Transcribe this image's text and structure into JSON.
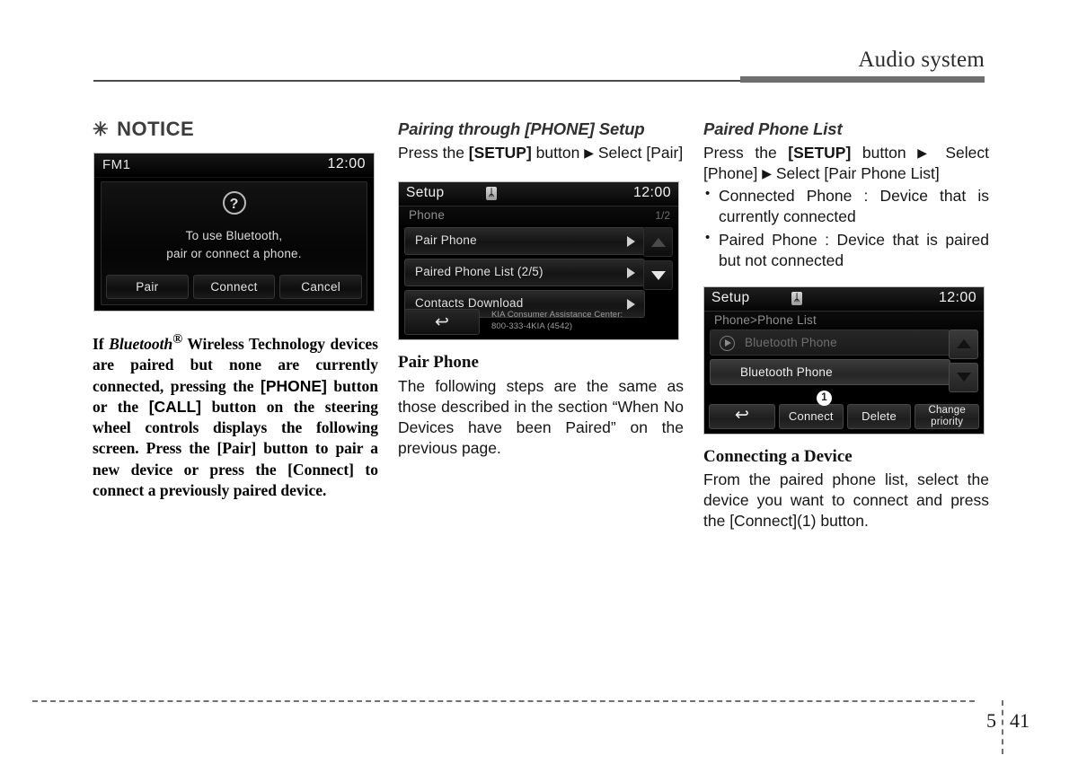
{
  "header": {
    "title": "Audio system"
  },
  "footer": {
    "chapter": "5",
    "page": "41"
  },
  "left_column": {
    "notice_asterisk": "✳",
    "notice_heading": "NOTICE",
    "screen": {
      "source_label": "FM1",
      "clock": "12:00",
      "icon_question": "?",
      "message_line1": "To use Bluetooth,",
      "message_line2": "pair or connect a phone.",
      "buttons": [
        "Pair",
        "Connect",
        "Cancel"
      ]
    },
    "body_html": "If <em>Bluetooth</em><sup>®</sup> Wireless Technology devices are paired but none are currently connected, pressing the <span class=\"bracket-sans\">[PHONE]</span> button or the <span class=\"bracket-sans\">[CALL]</span> button on the steering wheel controls displays the following screen. Press the [Pair] button to pair a new device or press the [Connect] to connect a previously paired device."
  },
  "middle_column": {
    "heading": "Pairing through [PHONE] Setup",
    "instruction_html": "Press the <span class=\"bold\">[SETUP]</span> button <span class=\"tri\">▶</span> Select [Pair]",
    "screen": {
      "title": "Setup",
      "bluetooth_icon": "ᛦ",
      "clock": "12:00",
      "breadcrumb": "Phone",
      "page_indicator": "1/2",
      "rows": [
        {
          "label": "Pair Phone"
        },
        {
          "label": "Paired Phone List (2/5)"
        },
        {
          "label": "Contacts Download"
        }
      ],
      "back_glyph": "↩",
      "helpline_line1": "KIA Consumer Assistance Center:",
      "helpline_line2": "800-333-4KIA (4542)"
    },
    "subheading": "Pair Phone",
    "body": "The following steps are the same as those described in the section “When No Devices have been Paired” on the previous page."
  },
  "right_column": {
    "heading": "Paired Phone List",
    "instruction_html": "Press the <span class=\"bold\">[SETUP]</span> button <span class=\"tri\">▶</span> Select [Phone] <span class=\"tri\">▶</span> Select [Pair Phone List]",
    "bullets": [
      "Connected Phone : Device that is currently connected",
      "Paired Phone : Device that is paired but not connected"
    ],
    "screen": {
      "title": "Setup",
      "bluetooth_icon": "ᛦ",
      "clock": "12:00",
      "breadcrumb": "Phone>Phone List",
      "rows": [
        {
          "label": "Bluetooth Phone",
          "state": "connected"
        },
        {
          "label": "Bluetooth Phone",
          "state": "paired"
        }
      ],
      "callout_number": "1",
      "back_glyph": "↩",
      "buttons": [
        "Connect",
        "Delete",
        "Change priority"
      ]
    },
    "subheading": "Connecting a Device",
    "body": "From the paired phone list, select the device you want to connect and press the [Connect](1) button."
  }
}
